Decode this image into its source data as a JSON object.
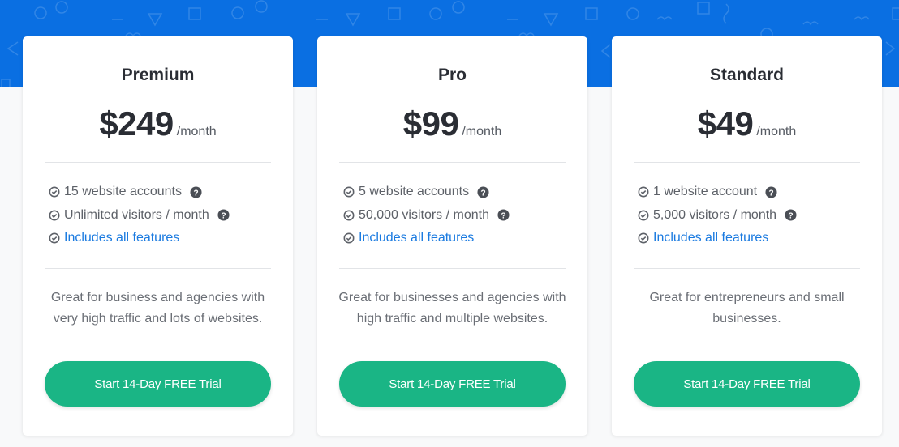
{
  "colors": {
    "hero_background": "#0a6fe2",
    "cta_button": "#1ab585",
    "link": "#1a7ae0"
  },
  "plans": [
    {
      "name": "Premium",
      "price": "$249",
      "period": "/month",
      "features": [
        {
          "text": "15 website accounts",
          "icon": "check-circle-icon",
          "help": true,
          "link": false
        },
        {
          "text": "Unlimited visitors / month",
          "icon": "check-circle-icon",
          "help": true,
          "link": false
        },
        {
          "text": "Includes all features",
          "icon": "check-circle-icon",
          "help": false,
          "link": true
        }
      ],
      "description": "Great for business and agencies with very high traffic and lots of websites.",
      "cta_label": "Start 14-Day FREE Trial"
    },
    {
      "name": "Pro",
      "price": "$99",
      "period": "/month",
      "features": [
        {
          "text": "5 website accounts",
          "icon": "check-circle-icon",
          "help": true,
          "link": false
        },
        {
          "text": "50,000 visitors / month",
          "icon": "check-circle-icon",
          "help": true,
          "link": false
        },
        {
          "text": "Includes all features",
          "icon": "check-circle-icon",
          "help": false,
          "link": true
        }
      ],
      "description": "Great for businesses and agencies with high traffic and multiple websites.",
      "cta_label": "Start 14-Day FREE Trial"
    },
    {
      "name": "Standard",
      "price": "$49",
      "period": "/month",
      "features": [
        {
          "text": "1 website account",
          "icon": "check-circle-icon",
          "help": true,
          "link": false
        },
        {
          "text": "5,000 visitors / month",
          "icon": "check-circle-icon",
          "help": true,
          "link": false
        },
        {
          "text": "Includes all features",
          "icon": "check-circle-icon",
          "help": false,
          "link": true
        }
      ],
      "description": "Great for entrepreneurs and small businesses.",
      "cta_label": "Start 14-Day FREE Trial"
    }
  ]
}
